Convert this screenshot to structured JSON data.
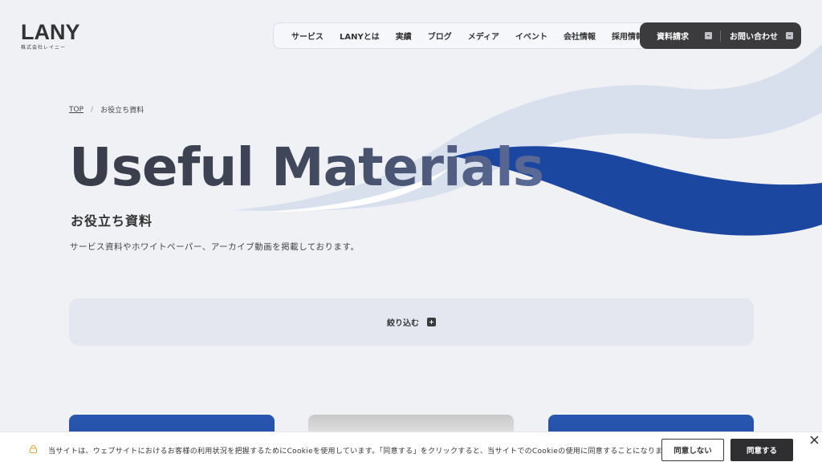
{
  "brand": {
    "name": "LANY",
    "subtitle": "株式会社レイニー"
  },
  "nav": {
    "items": [
      "サービス",
      "LANYとは",
      "実績",
      "ブログ",
      "メディア",
      "イベント",
      "会社情報",
      "採用情報"
    ]
  },
  "cta": {
    "request_label": "資料請求",
    "contact_label": "お問い合わせ"
  },
  "breadcrumb": {
    "home": "TOP",
    "separator": "/",
    "current": "お役立ち資料"
  },
  "hero": {
    "title": "Useful Materials",
    "subtitle": "お役立ち資料",
    "description": "サービス資料やホワイトペーパー、アーカイブ動画を掲載しております。"
  },
  "filter": {
    "label": "絞り込む"
  },
  "cookie": {
    "message": "当サイトは、ウェブサイトにおけるお客様の利用状況を把握するためにCookieを使用しています。「同意する」をクリックすると、当サイトでのCookieの使用に同意することになります。",
    "decline_label": "同意しない",
    "accept_label": "同意する"
  },
  "colors": {
    "background": "#f0f1f5",
    "dark": "#3b3b3d",
    "wave_blue": "#1c47a0",
    "wave_light": "#d6deed"
  }
}
